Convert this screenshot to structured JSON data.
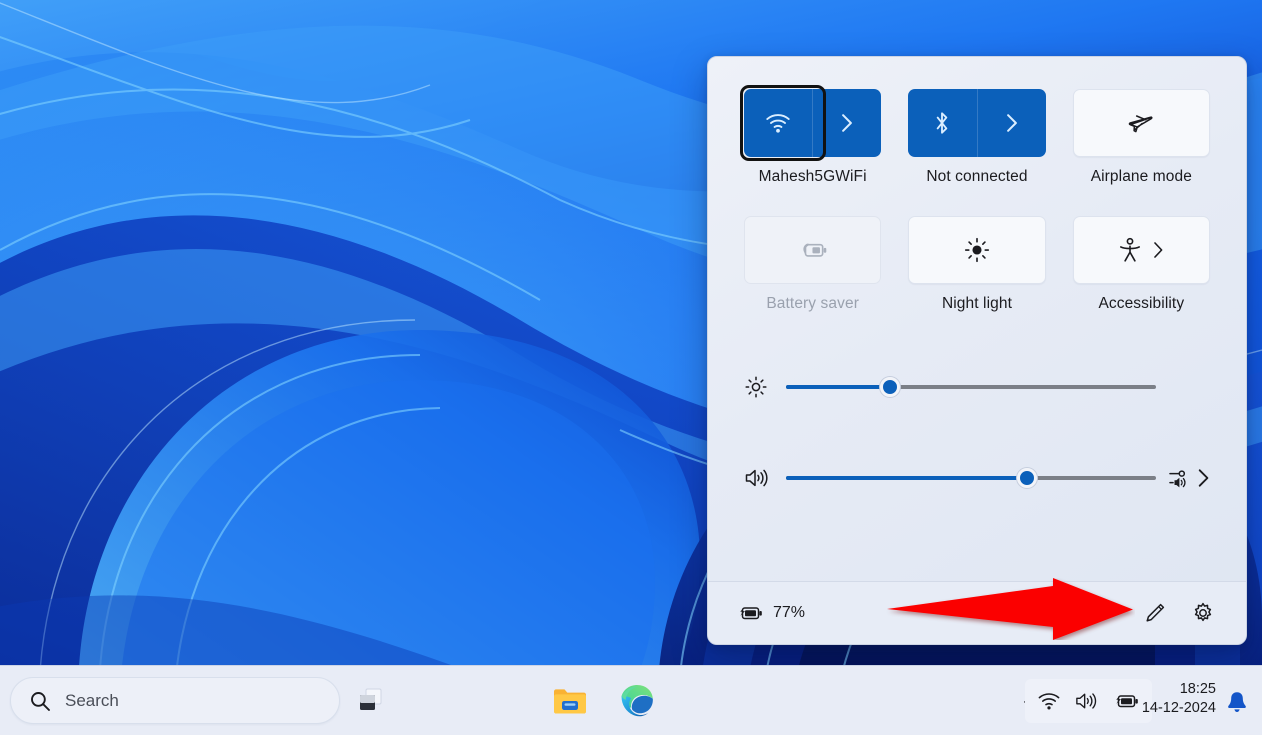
{
  "desktop": {
    "wallpaper_name": "windows-bloom-wallpaper",
    "colors": {
      "deep_blue": "#0a2f9e",
      "mid_blue": "#1560e8",
      "light_blue": "#39a0f7",
      "accent": "#0b60ba",
      "callout_red": "#fb0000"
    }
  },
  "quick_settings": {
    "panel_name": "Quick Settings",
    "tiles": [
      {
        "id": "wifi",
        "label": "Mahesh5GWiFi",
        "icon": "wifi-icon",
        "state": "on",
        "has_chevron": true,
        "focused": true
      },
      {
        "id": "bluetooth",
        "label": "Not connected",
        "icon": "bluetooth-icon",
        "state": "on",
        "has_chevron": true,
        "focused": false
      },
      {
        "id": "airplane",
        "label": "Airplane mode",
        "icon": "airplane-icon",
        "state": "off",
        "has_chevron": false,
        "focused": false
      },
      {
        "id": "battery-saver",
        "label": "Battery saver",
        "icon": "battery-saver-icon",
        "state": "disabled",
        "has_chevron": false,
        "focused": false
      },
      {
        "id": "night-light",
        "label": "Night light",
        "icon": "brightness-icon",
        "state": "off",
        "has_chevron": false,
        "focused": false
      },
      {
        "id": "accessibility",
        "label": "Accessibility",
        "icon": "accessibility-icon",
        "state": "off",
        "has_chevron": true,
        "focused": false
      }
    ],
    "sliders": [
      {
        "id": "brightness",
        "icon": "brightness-icon",
        "value": 28,
        "min": 0,
        "max": 100,
        "trailing_icon": null
      },
      {
        "id": "volume",
        "icon": "volume-icon",
        "value": 65,
        "min": 0,
        "max": 100,
        "trailing_icon": "audio-output-icon"
      }
    ],
    "footer": {
      "battery_icon": "battery-charging-icon",
      "battery_percent": "77%",
      "edit_label": "Edit quick settings",
      "settings_label": "All settings"
    }
  },
  "annotation": {
    "type": "arrow",
    "direction": "right",
    "color": "#fb0000",
    "points_at": "edit-quick-settings-button"
  },
  "taskbar": {
    "search": {
      "placeholder": "Search",
      "value": "",
      "icon": "search-icon"
    },
    "buttons": [
      {
        "id": "task-view",
        "icon": "task-view-icon",
        "active": false
      },
      {
        "id": "file-explorer",
        "icon": "file-explorer-icon",
        "active": false
      },
      {
        "id": "microsoft-edge",
        "icon": "edge-icon",
        "active": true
      }
    ],
    "tray": {
      "overflow_icon": "chevron-up-icon",
      "icons": [
        {
          "id": "wifi",
          "icon": "wifi-icon"
        },
        {
          "id": "volume",
          "icon": "volume-icon"
        },
        {
          "id": "battery",
          "icon": "battery-charging-icon"
        }
      ]
    },
    "clock": {
      "time": "18:25",
      "date": "14-12-2024"
    },
    "notifications": {
      "icon": "bell-icon",
      "color": "#1455c8"
    }
  }
}
